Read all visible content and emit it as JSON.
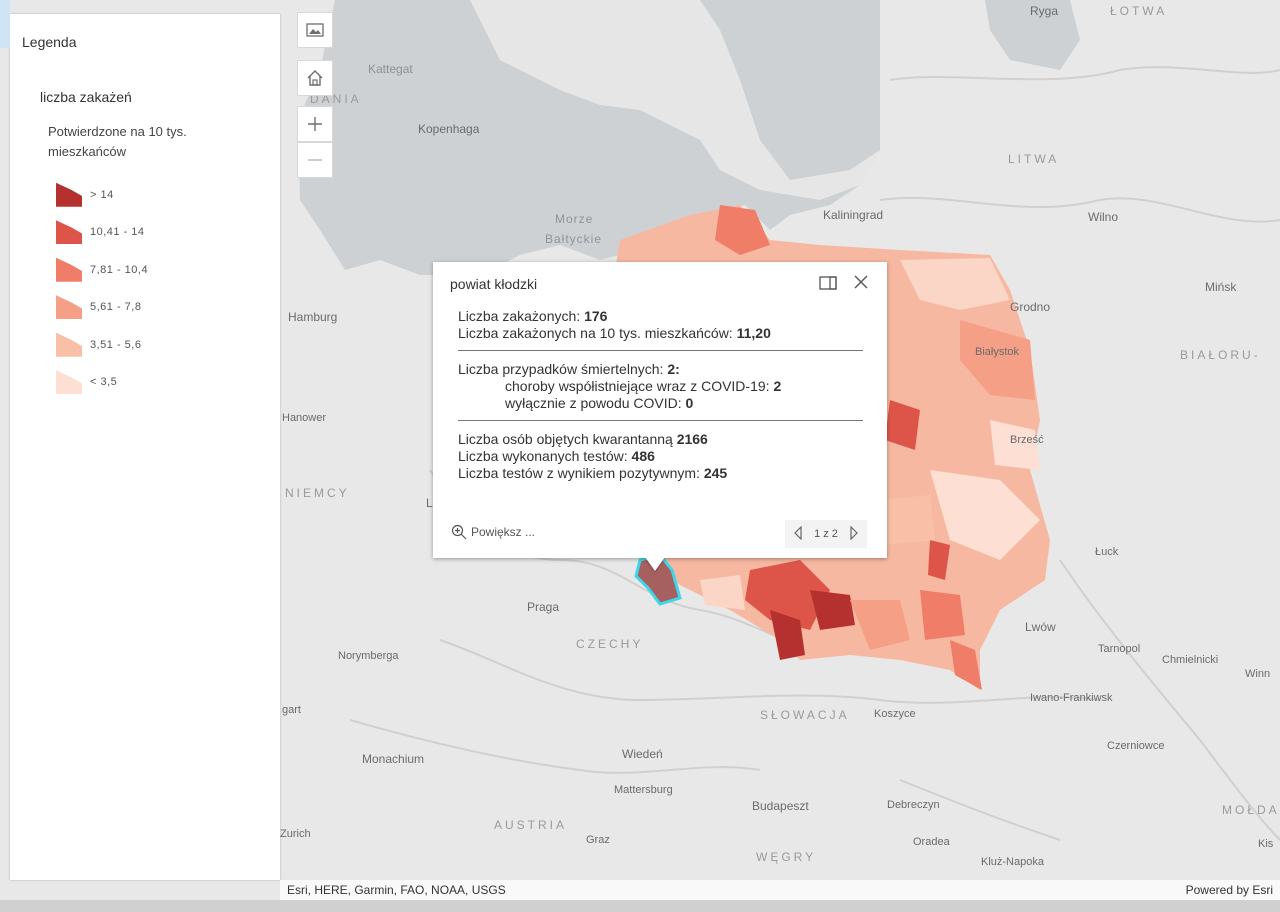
{
  "legend": {
    "heading": "Legenda",
    "layer_title": "liczba zakażeń",
    "field_title": "Potwierdzone na 10 tys. mieszkańców",
    "items": [
      {
        "label": "> 14",
        "color": "#b5312f"
      },
      {
        "label": "10,41 - 14",
        "color": "#dd5549"
      },
      {
        "label": "7,81 - 10,4",
        "color": "#ef7d68"
      },
      {
        "label": "5,61 - 7,8",
        "color": "#f59f86"
      },
      {
        "label": "3,51 - 5,6",
        "color": "#f9bfa7"
      },
      {
        "label": "< 3,5",
        "color": "#fde0d3"
      }
    ]
  },
  "map_labels": {
    "ryga": "Ryga",
    "lotwa": "ŁOTWA",
    "kattegat": "Kattegat",
    "dania": "DANIA",
    "kopenhaga": "Kopenhaga",
    "litwa": "LITWA",
    "morze": "Morze",
    "baltyckie": "Bałtyckie",
    "kaliningrad": "Kaliningrad",
    "wilno": "Wilno",
    "minsk": "Mińsk",
    "grodno": "Grodno",
    "hamburg": "Hamburg",
    "bialorus": "BIAŁORU-",
    "bialystok": "Białystok",
    "hanower": "Hanower",
    "brzesc": "Brześć",
    "niemcy": "NIEMCY",
    "l": "L",
    "luck": "Łuck",
    "praga": "Praga",
    "czechy": "CZECHY",
    "lwow": "Lwów",
    "tarnopol": "Tarnopol",
    "chmielnicki": "Chmielnicki",
    "winn": "Winn",
    "norymberga": "Norymberga",
    "iwano": "Iwano-Frankiwsk",
    "gart": "gart",
    "slowacja": "SŁOWACJA",
    "koszyce": "Koszyce",
    "monachium": "Monachium",
    "wieden": "Wiedeń",
    "czerniowce": "Czerniowce",
    "mattersburg": "Mattersburg",
    "budapeszt": "Budapeszt",
    "debreczyn": "Debreczyn",
    "moldawia": "MOŁDA",
    "austria": "AUSTRIA",
    "graz": "Graz",
    "oradea": "Oradea",
    "kis": "Kis",
    "zurich": "Zurich",
    "wegry": "WĘGRY",
    "kluz": "Kluż-Napoka"
  },
  "popup": {
    "title": "powiat kłodzki",
    "infected_label": "Liczba zakażonych:",
    "infected_value": "176",
    "per10k_label": "Liczba zakażonych na 10 tys. mieszkańców:",
    "per10k_value": "11,20",
    "deaths_label": "Liczba przypadków śmiertelnych:",
    "deaths_value": "2:",
    "comorb_label": "choroby współistniejące wraz z COVID-19:",
    "comorb_value": "2",
    "covid_only_label": "wyłącznie z powodu COVID:",
    "covid_only_value": "0",
    "quarantine_label": "Liczba osób objętych kwarantanną",
    "quarantine_value": "2166",
    "tests_label": "Liczba wykonanych testów:",
    "tests_value": "486",
    "positive_label": "Liczba testów z wynikiem pozytywnym:",
    "positive_value": "245",
    "zoom_label": "Powiększ ...",
    "pager": "1 z 2"
  },
  "attribution": {
    "sources": "Esri, HERE, Garmin, FAO, NOAA, USGS",
    "powered_by": "Powered by Esri"
  },
  "icons": [
    "basemap-icon",
    "home-icon",
    "zoom-in-icon",
    "zoom-out-icon",
    "dock-icon",
    "close-icon",
    "zoom-to-icon",
    "prev-icon",
    "next-icon"
  ]
}
